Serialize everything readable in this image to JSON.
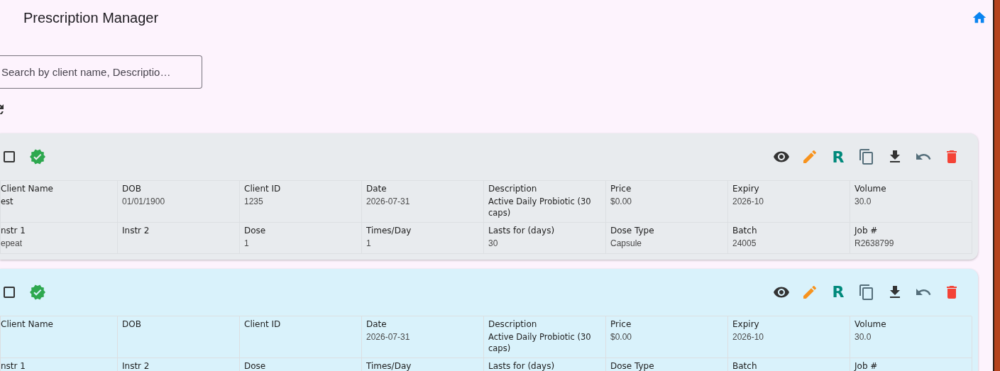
{
  "app_bar": {
    "title": "Prescription Manager"
  },
  "search": {
    "placeholder": "Search by client name, Descriptio…"
  },
  "cards": [
    {
      "color": "#e8ebee",
      "checked": false,
      "actions": [
        {
          "kind": "view"
        },
        {
          "kind": "edit"
        },
        {
          "kind": "letter",
          "label": "R"
        },
        {
          "kind": "copy"
        },
        {
          "kind": "download"
        },
        {
          "kind": "undo"
        },
        {
          "kind": "delete"
        }
      ],
      "rows": [
        [
          {
            "label": "Client Name",
            "value": "est",
            "strong": true
          },
          {
            "label": "DOB",
            "value": "01/01/1900"
          },
          {
            "label": "Client ID",
            "value": "1235"
          },
          {
            "label": "Date",
            "value": "2026-07-31"
          },
          {
            "label": "Description",
            "value": "Active Daily Probiotic (30 caps)",
            "strong": true
          },
          {
            "label": "Price",
            "value": "$0.00"
          },
          {
            "label": "Expiry",
            "value": "2026-10"
          },
          {
            "label": "Volume",
            "value": "30.0"
          }
        ],
        [
          {
            "label": "nstr 1",
            "value": "epeat"
          },
          {
            "label": "Instr 2"
          },
          {
            "label": "Dose",
            "value": "1"
          },
          {
            "label": "Times/Day",
            "value": "1"
          },
          {
            "label": "Lasts for (days)",
            "value": "30"
          },
          {
            "label": "Dose Type",
            "value": "Capsule"
          },
          {
            "label": "Batch",
            "value": "24005"
          },
          {
            "label": "Job #",
            "value": "R2638799"
          }
        ]
      ]
    },
    {
      "color": "#d9f2fb",
      "checked": false,
      "actions": [
        {
          "kind": "view"
        },
        {
          "kind": "edit"
        },
        {
          "kind": "letter",
          "label": "R"
        },
        {
          "kind": "copy"
        },
        {
          "kind": "download"
        },
        {
          "kind": "undo"
        },
        {
          "kind": "delete"
        }
      ],
      "rows": [
        [
          {
            "label": "Client Name"
          },
          {
            "label": "DOB"
          },
          {
            "label": "Client ID"
          },
          {
            "label": "Date",
            "value": "2026-07-31"
          },
          {
            "label": "Description",
            "value": "Active Daily Probiotic (30 caps)",
            "strong": true
          },
          {
            "label": "Price",
            "value": "$0.00"
          },
          {
            "label": "Expiry",
            "value": "2026-10"
          },
          {
            "label": "Volume",
            "value": "30.0"
          }
        ],
        [
          {
            "label": "nstr 1"
          },
          {
            "label": "Instr 2"
          },
          {
            "label": "Dose"
          },
          {
            "label": "Times/Day"
          },
          {
            "label": "Lasts for (days)"
          },
          {
            "label": "Dose Type"
          },
          {
            "label": "Batch"
          },
          {
            "label": "Job #"
          }
        ]
      ]
    }
  ]
}
